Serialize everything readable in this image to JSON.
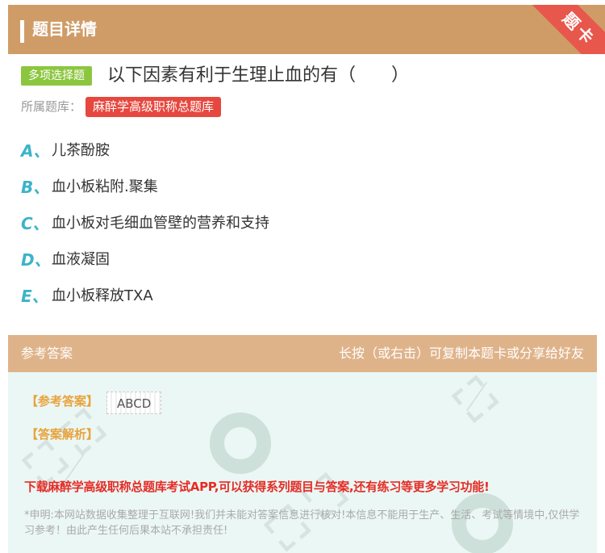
{
  "header": {
    "title": "题目详情",
    "ribbon": "题卡"
  },
  "question": {
    "type": "多项选择题",
    "text": "以下因素有利于生理止血的有（　　）",
    "bank_label": "所属题库：",
    "bank_name": "麻醉学高级职称总题库"
  },
  "options": [
    {
      "letter": "A、",
      "text": "儿茶酚胺"
    },
    {
      "letter": "B、",
      "text": "血小板粘附.聚集"
    },
    {
      "letter": "C、",
      "text": "血小板对毛细血管壁的营养和支持"
    },
    {
      "letter": "D、",
      "text": "血液凝固"
    },
    {
      "letter": "E、",
      "text": "血小板释放TXA"
    }
  ],
  "answer": {
    "section_label": "参考答案",
    "hint": "长按（或右击）可复制本题卡或分享给好友",
    "ref_label": "【参考答案】",
    "ref_value": "ABCD",
    "parse_label": "【答案解析】",
    "promo": "下载麻醉学高级职称总题库考试APP,可以获得系列题目与答案,还有练习等更多学习功能!",
    "disclaimer": "*申明:本网站数据收集整理于互联网!我们并未能对答案信息进行核对!本信息不能用于生产、生活、考试等情境中,仅供学习参考！由此产生任何后果本站不承担责任!"
  },
  "colors": {
    "header_bg": "#cf9c68",
    "ribbon": "#e8574c",
    "type_badge": "#8cc63f",
    "bank_badge": "#e6473e",
    "option_letter": "#3bb4c8",
    "answer_header": "#dfb38a",
    "answer_body": "#ebf7f4",
    "label_orange": "#e8a33c",
    "promo_red": "#e52c26"
  }
}
